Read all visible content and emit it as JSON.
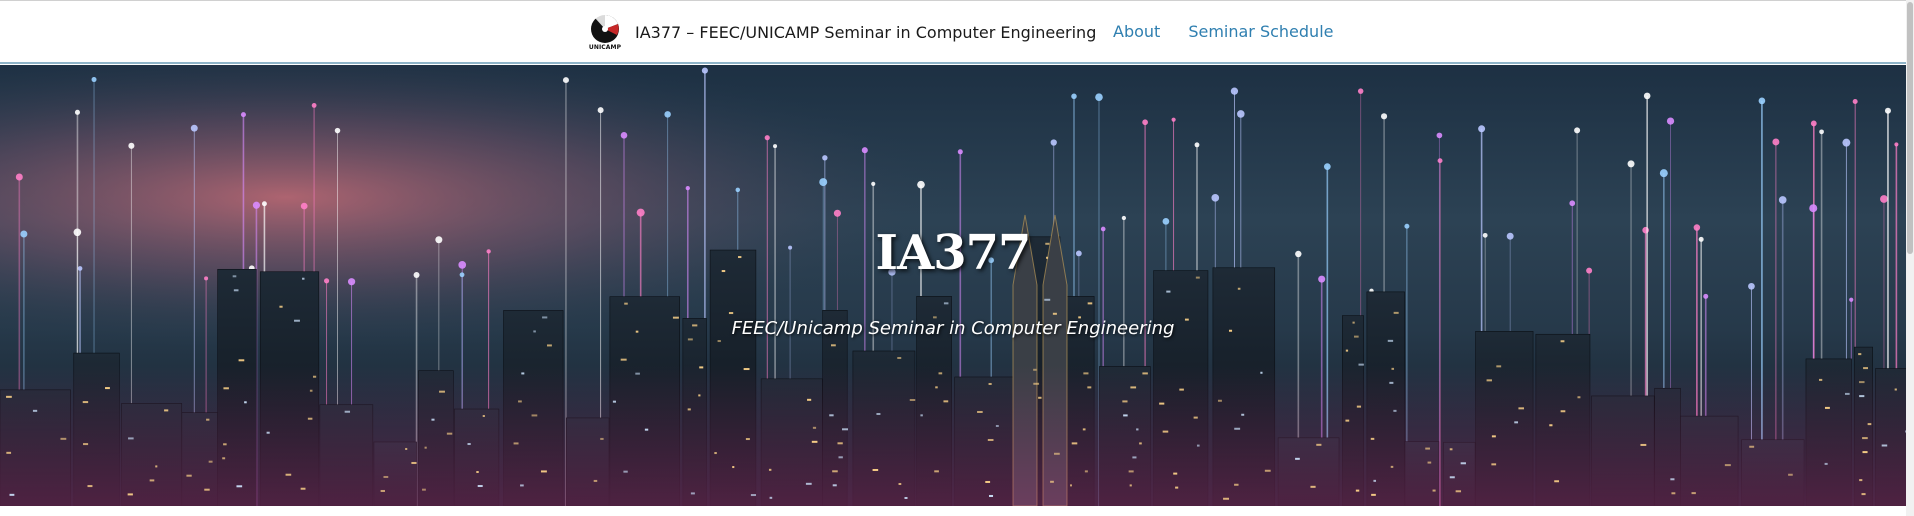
{
  "navbar": {
    "logo_text": "UNICAMP",
    "logo_icon": "unicamp-logo-icon",
    "title": "IA377 – FEEC/UNICAMP Seminar in Computer Engineering",
    "links": [
      {
        "label": "About"
      },
      {
        "label": "Seminar Schedule"
      }
    ],
    "link_color": "#2f7fb0"
  },
  "hero": {
    "title": "IA377",
    "subtitle": "FEEC/Unicamp Seminar in Computer Engineering",
    "background": "night city skyline with light beams"
  }
}
